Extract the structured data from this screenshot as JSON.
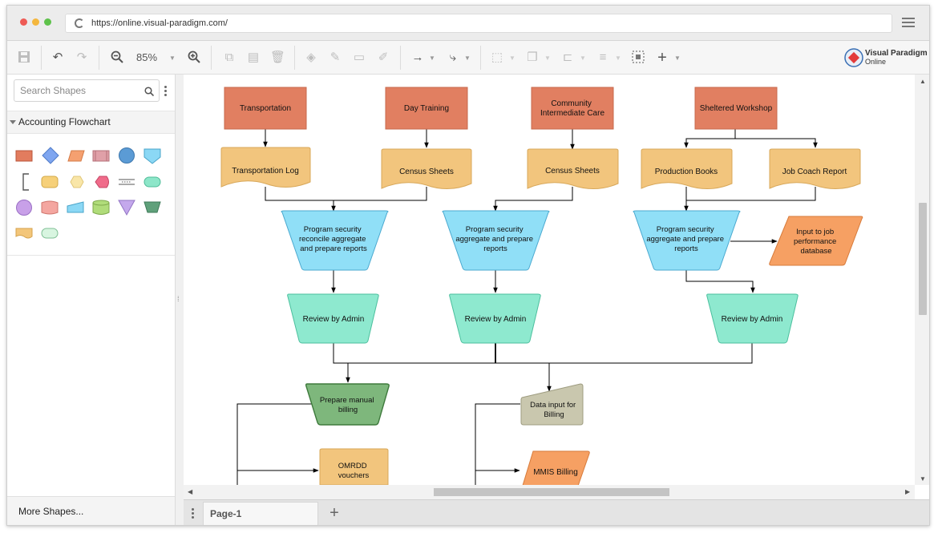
{
  "browser": {
    "url": "https://online.visual-paradigm.com/",
    "dot_colors": [
      "#ee5b55",
      "#f4b73e",
      "#5ec24b"
    ]
  },
  "toolbar": {
    "zoom": "85%",
    "logo_line1": "Visual Paradigm",
    "logo_line2": "Online"
  },
  "sidebar": {
    "search_placeholder": "Search Shapes",
    "category": "Accounting Flowchart",
    "more_shapes": "More Shapes...",
    "palette": [
      {
        "icon": "rectangle-shape-icon",
        "color": "#e27c5e"
      },
      {
        "icon": "diamond-shape-icon",
        "color": "#7fa6f0"
      },
      {
        "icon": "parallelogram-shape-icon",
        "color": "#f5a070"
      },
      {
        "icon": "predefined-process-icon",
        "color": "#e0a0a8"
      },
      {
        "icon": "circle-shape-icon",
        "color": "#5b9bd5"
      },
      {
        "icon": "offpage-connector-icon",
        "color": "#8bd8f5"
      },
      {
        "icon": "annotation-bracket-icon",
        "color": "#555555"
      },
      {
        "icon": "rounded-rect-icon",
        "color": "#f6d079"
      },
      {
        "icon": "hexagon-shape-icon",
        "color": "#f9e6a8"
      },
      {
        "icon": "display-shape-icon",
        "color": "#f06b8a"
      },
      {
        "icon": "dashed-line-icon",
        "color": "#555555"
      },
      {
        "icon": "terminator-shape-icon",
        "color": "#8de6c9"
      },
      {
        "icon": "purple-circle-icon",
        "color": "#c8a0e8"
      },
      {
        "icon": "tape-shape-icon",
        "color": "#f4a6a0"
      },
      {
        "icon": "manual-input-icon",
        "color": "#8bd8f5"
      },
      {
        "icon": "database-shape-icon",
        "color": "#b0dc7a"
      },
      {
        "icon": "merge-triangle-icon",
        "color": "#c4a8ec"
      },
      {
        "icon": "manual-operation-icon",
        "color": "#5fa07a"
      },
      {
        "icon": "document-shape-icon",
        "color": "#f3c67a"
      },
      {
        "icon": "light-terminator-icon",
        "color": "#d8f5e0"
      }
    ]
  },
  "diagram": {
    "sources": [
      "Transportation",
      "Day Training",
      "Community Intermediate Care",
      "Sheltered Workshop"
    ],
    "documents": [
      "Transportation Log",
      "Census Sheets",
      "Census Sheets",
      "Production Books",
      "Job Coach Report"
    ],
    "processes": [
      "Program security reconcile aggregate and prepare reports",
      "Program security aggregate and prepare reports",
      "Program security aggregate and prepare reports"
    ],
    "output": "Input to job performance database",
    "reviews": [
      "Review by Admin",
      "Review by Admin",
      "Review by Admin"
    ],
    "manual_billing": "Prepare manual billing",
    "data_input": "Data input for Billing",
    "omrdd": "OMRDD vouchers",
    "mmis": "MMIS Billing",
    "colors": {
      "source": "#e17f61",
      "document": "#f2c57d",
      "process": "#90dff7",
      "review": "#8ee9cf",
      "manual": "#7eb77c",
      "data_input": "#c9c7ae",
      "output": "#f6a063"
    }
  },
  "footer": {
    "page_tab": "Page-1"
  }
}
